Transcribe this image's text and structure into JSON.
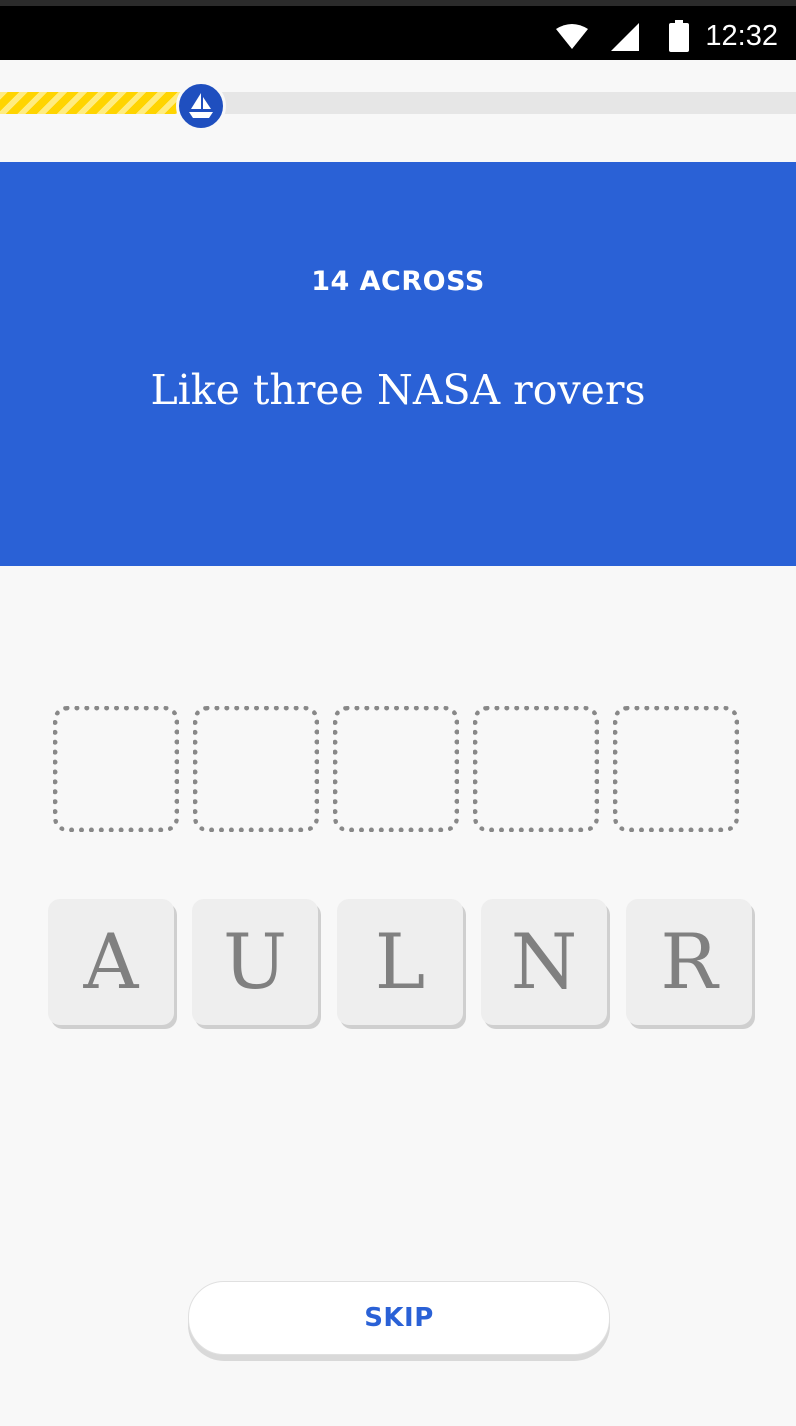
{
  "status_bar": {
    "time": "12:32",
    "icons": [
      "wifi-icon",
      "cell-signal-icon",
      "battery-icon"
    ]
  },
  "progress": {
    "fraction": 0.27,
    "marker_icon": "sailboat-icon",
    "fill_color": "#ffd400",
    "marker_color": "#1f4fbf"
  },
  "clue": {
    "number": "14 ACROSS",
    "text": "Like three NASA rovers",
    "panel_color": "#2a61d6"
  },
  "answer_slots": [
    "",
    "",
    "",
    "",
    ""
  ],
  "letter_tiles": [
    "A",
    "U",
    "L",
    "N",
    "R"
  ],
  "skip_label": "SKIP"
}
